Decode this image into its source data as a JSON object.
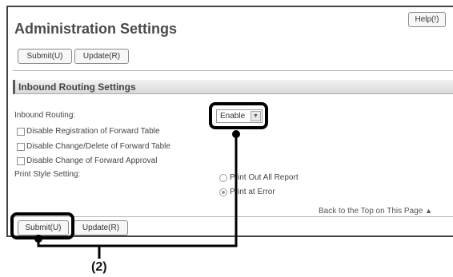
{
  "header": {
    "title": "Administration Settings",
    "help_label": "Help(!)"
  },
  "top_buttons": {
    "submit_label": "Submit(U)",
    "update_label": "Update(R)"
  },
  "section": {
    "title": "Inbound Routing Settings"
  },
  "form": {
    "inbound_routing_label": "Inbound Routing:",
    "inbound_routing_value": "Enable",
    "checkboxes": [
      {
        "label": "Disable Registration of Forward Table",
        "checked": false
      },
      {
        "label": "Disable Change/Delete of Forward Table",
        "checked": false
      },
      {
        "label": "Disable Change of Forward Approval",
        "checked": false
      }
    ],
    "print_style_label": "Print Style Setting:",
    "print_style_options": [
      {
        "label": "Print Out All Report",
        "selected": false
      },
      {
        "label": "Print at Error",
        "selected": true
      }
    ]
  },
  "footer": {
    "back_to_top": "Back to the Top on This Page",
    "back_to_top_icon": "triangle-up-icon",
    "submit_label": "Submit(U)",
    "update_label": "Update(R)"
  },
  "annotation": {
    "number": "(2)",
    "highlight_color": "#000000"
  }
}
